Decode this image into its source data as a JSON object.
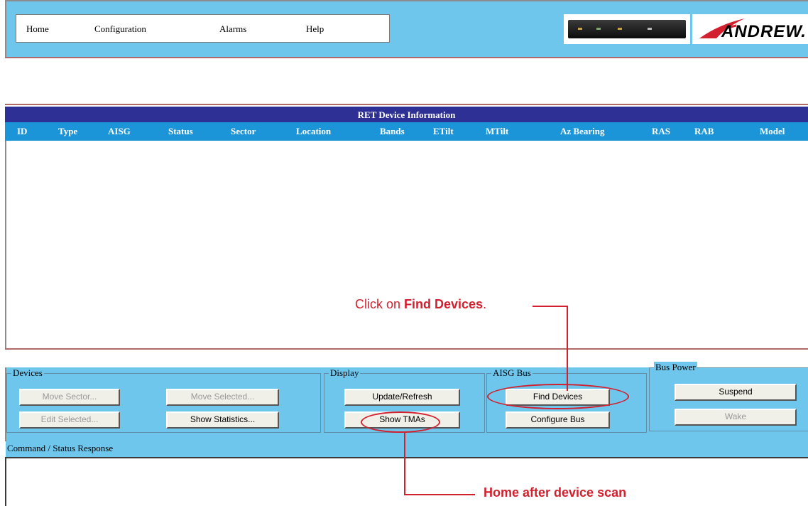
{
  "nav": {
    "items": [
      "Home",
      "Configuration",
      "Alarms",
      "Help"
    ]
  },
  "logo": {
    "text": "ANDREW."
  },
  "ret_table": {
    "title": "RET Device Information",
    "columns": [
      "ID",
      "Type",
      "AISG",
      "Status",
      "Sector",
      "Location",
      "Bands",
      "ETilt",
      "MTilt",
      "Az Bearing",
      "RAS",
      "RAB",
      "Model"
    ]
  },
  "groups": {
    "devices": {
      "label": "Devices",
      "buttons": [
        "Move Sector...",
        "Move Selected...",
        "Edit Selected...",
        "Show Statistics..."
      ]
    },
    "display": {
      "label": "Display",
      "buttons": [
        "Update/Refresh",
        "Show TMAs"
      ]
    },
    "aisg_bus": {
      "label": "AISG Bus",
      "buttons": [
        "Find Devices",
        "Configure Bus"
      ]
    },
    "bus_power": {
      "label": "Bus Power",
      "buttons": [
        "Suspend",
        "Wake"
      ]
    }
  },
  "command_status": {
    "label": "Command / Status Response"
  },
  "annotations": {
    "click_prefix": "Click on ",
    "click_bold": "Find Devices",
    "click_suffix": ".",
    "home_after_scan": "Home after device scan"
  },
  "colors": {
    "nav_bg": "#6fc6ec",
    "table_title_bg": "#2f3095",
    "table_header_bg": "#1b95d8",
    "annotation_red": "#d2202e"
  }
}
